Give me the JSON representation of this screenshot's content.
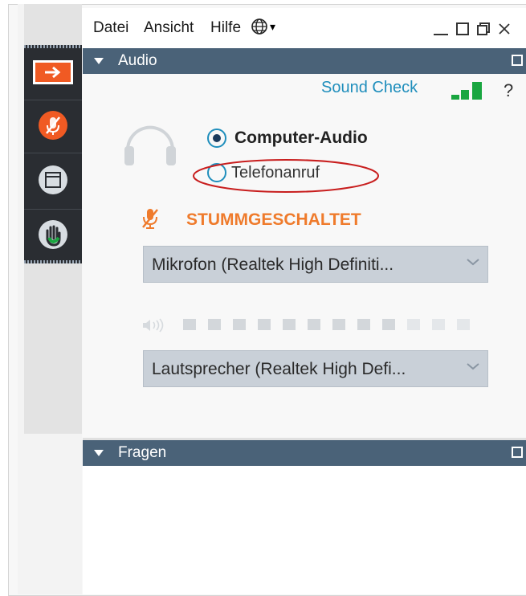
{
  "menu": {
    "datei": "Datei",
    "ansicht": "Ansicht",
    "hilfe": "Hilfe",
    "globe_caret": "▾"
  },
  "audio_panel": {
    "title": "Audio",
    "sound_check": "Sound Check",
    "help": "?",
    "options": [
      {
        "label": "Computer-Audio",
        "selected": true
      },
      {
        "label": "Telefonanruf",
        "selected": false
      }
    ],
    "mute_status": "STUMMGESCHALTET",
    "microphone": {
      "value": "Mikrofon (Realtek High Definiti..."
    },
    "speaker": {
      "value": "Lautsprecher (Realtek High Defi..."
    },
    "speaker_level": {
      "filled_segments": 9,
      "total_segments": 12
    }
  },
  "fragen_panel": {
    "title": "Fragen"
  },
  "colors": {
    "accent_orange": "#f05a23",
    "mute_text": "#ef7b2c",
    "panel_header": "#4a6278",
    "sound_check": "#1f8ebc",
    "signal_green": "#19a640",
    "annotation_red": "#c81e1e"
  },
  "icons": [
    "globe-icon",
    "minimize-icon",
    "maximize-icon",
    "restore-icon",
    "close-icon",
    "arrow-right-icon",
    "muted-mic-icon",
    "window-icon",
    "raise-hand-icon",
    "headset-icon",
    "speaker-icon",
    "signal-bars-icon"
  ]
}
